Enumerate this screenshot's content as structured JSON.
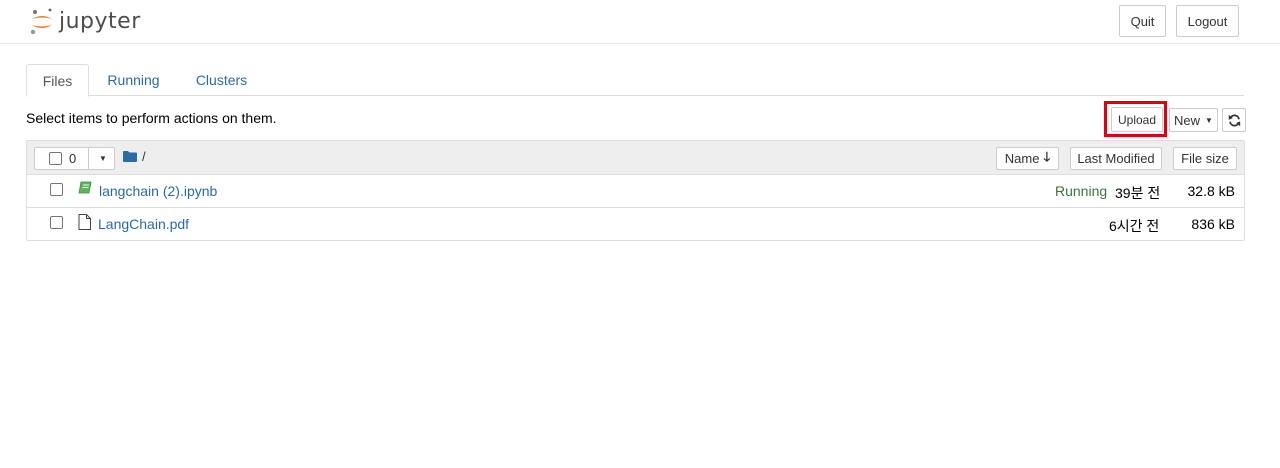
{
  "header": {
    "logo_text": "jupyter",
    "quit_label": "Quit",
    "logout_label": "Logout"
  },
  "tabs": [
    {
      "label": "Files",
      "active": true
    },
    {
      "label": "Running",
      "active": false
    },
    {
      "label": "Clusters",
      "active": false
    }
  ],
  "toolbar": {
    "hint": "Select items to perform actions on them.",
    "upload_label": "Upload",
    "new_label": "New",
    "refresh_icon": "refresh-icon"
  },
  "list": {
    "selected_count": "0",
    "path": "/",
    "sort_name_label": "Name",
    "sort_modified_label": "Last Modified",
    "sort_size_label": "File size",
    "rows": [
      {
        "icon": "notebook-icon",
        "name": "langchain (2).ipynb",
        "status": "Running",
        "modified": "39분 전",
        "size": "32.8 kB"
      },
      {
        "icon": "file-icon",
        "name": "LangChain.pdf",
        "status": "",
        "modified": "6시간 전",
        "size": "836 kB"
      }
    ]
  },
  "colors": {
    "link": "#2a6ba8",
    "running": "#3c763d",
    "highlight": "#e0000f",
    "logo_orange": "#f37626"
  }
}
